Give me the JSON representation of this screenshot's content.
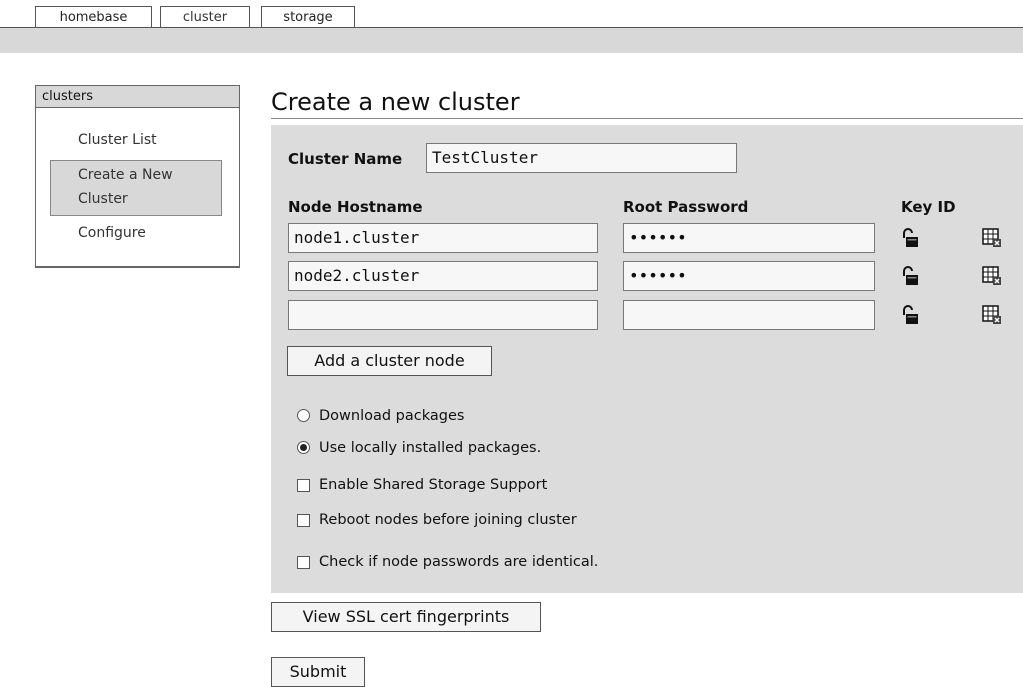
{
  "tabs": [
    {
      "label": "homebase"
    },
    {
      "label": "cluster"
    },
    {
      "label": "storage"
    }
  ],
  "sidebar": {
    "header": "clusters",
    "items": [
      {
        "label": "Cluster List"
      },
      {
        "label_line1": "Create a New",
        "label_line2": "Cluster"
      },
      {
        "label": "Configure"
      }
    ]
  },
  "main": {
    "title": "Create a new cluster",
    "cluster_name_label": "Cluster Name",
    "cluster_name_value": "TestCluster",
    "columns": {
      "hostname": "Node Hostname",
      "password": "Root Password",
      "key_id": "Key ID"
    },
    "nodes": [
      {
        "hostname": "node1.cluster",
        "password": "••••••"
      },
      {
        "hostname": "node2.cluster",
        "password": "••••••"
      },
      {
        "hostname": "",
        "password": ""
      }
    ],
    "add_node_label": "Add a cluster node",
    "options": {
      "download": "Download packages",
      "local": "Use locally installed packages.",
      "shared_storage": "Enable Shared Storage Support",
      "reboot": "Reboot nodes before joining cluster",
      "identical_pw": "Check if node passwords are identical."
    },
    "view_ssl_label": "View SSL cert fingerprints",
    "submit_label": "Submit"
  },
  "icons": {
    "key": "unlock-icon",
    "remove": "delete-row-icon"
  }
}
